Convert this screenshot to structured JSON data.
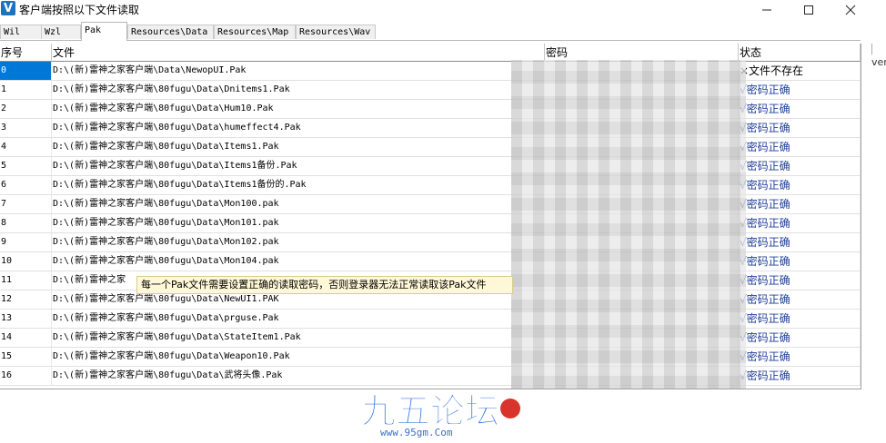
{
  "window": {
    "title": "客户端按照以下文件读取",
    "icon_letter": "V"
  },
  "tabs": [
    {
      "label": "Wil",
      "active": false
    },
    {
      "label": "Wzl",
      "active": false
    },
    {
      "label": "Pak",
      "active": true
    },
    {
      "label": "Resources\\Data",
      "active": false
    },
    {
      "label": "Resources\\Map",
      "active": false
    },
    {
      "label": "Resources\\Wav",
      "active": false
    }
  ],
  "grid": {
    "columns": [
      "序号",
      "文件",
      "密码",
      "状态"
    ],
    "rows": [
      {
        "idx": "0",
        "file": "D:\\(新)雷神之家客户端\\Data\\NewopUI.Pak",
        "status": "×文件不存在"
      },
      {
        "idx": "1",
        "file": "D:\\(新)雷神之家客户端\\80fugu\\Data\\Dnitems1.Pak",
        "status": "√密码正确"
      },
      {
        "idx": "2",
        "file": "D:\\(新)雷神之家客户端\\80fugu\\Data\\Hum10.Pak",
        "status": "√密码正确"
      },
      {
        "idx": "3",
        "file": "D:\\(新)雷神之家客户端\\80fugu\\Data\\humeffect4.Pak",
        "status": "√密码正确"
      },
      {
        "idx": "4",
        "file": "D:\\(新)雷神之家客户端\\80fugu\\Data\\Items1.Pak",
        "status": "√密码正确"
      },
      {
        "idx": "5",
        "file": "D:\\(新)雷神之家客户端\\80fugu\\Data\\Items1备份.Pak",
        "status": "√密码正确"
      },
      {
        "idx": "6",
        "file": "D:\\(新)雷神之家客户端\\80fugu\\Data\\Items1备份的.Pak",
        "status": "√密码正确"
      },
      {
        "idx": "7",
        "file": "D:\\(新)雷神之家客户端\\80fugu\\Data\\Mon100.pak",
        "status": "√密码正确"
      },
      {
        "idx": "8",
        "file": "D:\\(新)雷神之家客户端\\80fugu\\Data\\Mon101.pak",
        "status": "√密码正确"
      },
      {
        "idx": "9",
        "file": "D:\\(新)雷神之家客户端\\80fugu\\Data\\Mon102.pak",
        "status": "√密码正确"
      },
      {
        "idx": "10",
        "file": "D:\\(新)雷神之家客户端\\80fugu\\Data\\Mon104.pak",
        "status": "√密码正确"
      },
      {
        "idx": "11",
        "file": "D:\\(新)雷神之家",
        "status": "√密码正确"
      },
      {
        "idx": "12",
        "file": "D:\\(新)雷神之家客户端\\80fugu\\Data\\NewUI1.PAK",
        "status": "√密码正确"
      },
      {
        "idx": "13",
        "file": "D:\\(新)雷神之家客户端\\80fugu\\Data\\prguse.Pak",
        "status": "√密码正确"
      },
      {
        "idx": "14",
        "file": "D:\\(新)雷神之家客户端\\80fugu\\Data\\StateItem1.Pak",
        "status": "√密码正确"
      },
      {
        "idx": "15",
        "file": "D:\\(新)雷神之家客户端\\80fugu\\Data\\Weapon10.Pak",
        "status": "√密码正确"
      },
      {
        "idx": "16",
        "file": "D:\\(新)雷神之家客户端\\80fugu\\Data\\武将头像.Pak",
        "status": "√密码正确"
      }
    ]
  },
  "tooltip": "每一个Pak文件需要设置正确的读取密码，否则登录器无法正常读取该Pak文件",
  "edge_text": "ver",
  "watermark": {
    "logo_text": "九五论坛",
    "url": "www.95gm.Com"
  },
  "colors": {
    "selection": "#0078d7",
    "status_ok": "#1f3f99",
    "status_missing": "#000000"
  }
}
